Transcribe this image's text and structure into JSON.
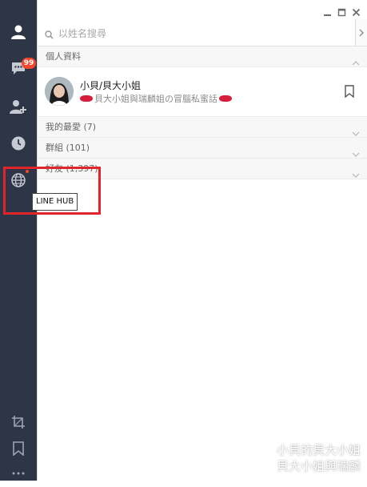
{
  "sidebar": {
    "chat_badge": "99",
    "tooltip": "LINE HUB",
    "items": [
      {
        "name": "friends-icon"
      },
      {
        "name": "chats-icon"
      },
      {
        "name": "add-friend-icon"
      },
      {
        "name": "timeline-icon"
      },
      {
        "name": "line-hub-icon"
      },
      {
        "name": "crop-icon"
      },
      {
        "name": "keep-icon"
      },
      {
        "name": "more-icon"
      }
    ],
    "highlight_color": "#e1262b"
  },
  "search": {
    "placeholder": "以姓名搜尋"
  },
  "sections": {
    "profile_header": "個人資料",
    "favorites": "我的最愛 (7)",
    "groups": "群組 (101)",
    "friends": "好友 (1,397)"
  },
  "profile": {
    "name": "小貝/貝大小姐",
    "status": "貝大小姐與瑞麟姐の冒腦私蜜話"
  },
  "watermark": {
    "line1": "小貝的貝大小姐",
    "line2": "貝大小姐與瑞麟"
  },
  "colors": {
    "sidebar_bg": "#2e3546",
    "badge": "#f0492d"
  }
}
